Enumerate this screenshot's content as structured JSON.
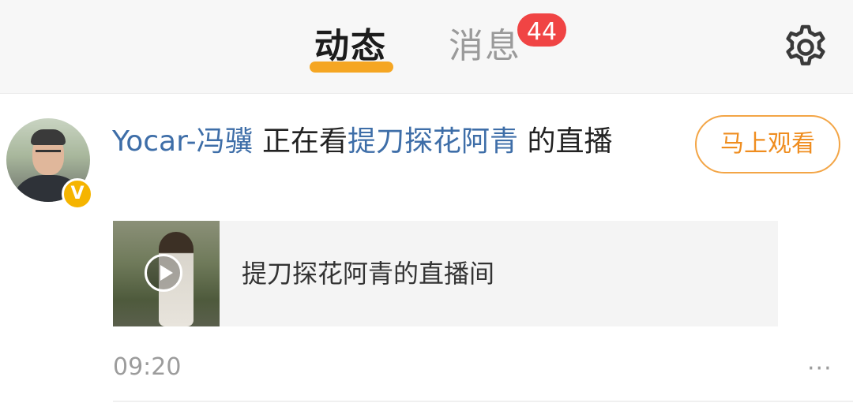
{
  "header": {
    "tabs": [
      {
        "label": "动态",
        "active": true
      },
      {
        "label": "消息",
        "active": false,
        "badge": "44"
      }
    ],
    "settings_icon": "gear-icon"
  },
  "feed_item": {
    "user_name": "Yocar-冯骥",
    "action_text": "正在看",
    "streamer_name": "提刀探花阿青",
    "suffix_text": "的直播",
    "verified_badge": "V",
    "watch_button_label": "马上观看",
    "live_room_title": "提刀探花阿青的直播间",
    "timestamp": "09:20",
    "more_icon": "···"
  },
  "colors": {
    "accent_orange": "#f5a623",
    "badge_red": "#f04444",
    "link_blue": "#3e6ea8",
    "button_orange": "#ef8d1f"
  }
}
